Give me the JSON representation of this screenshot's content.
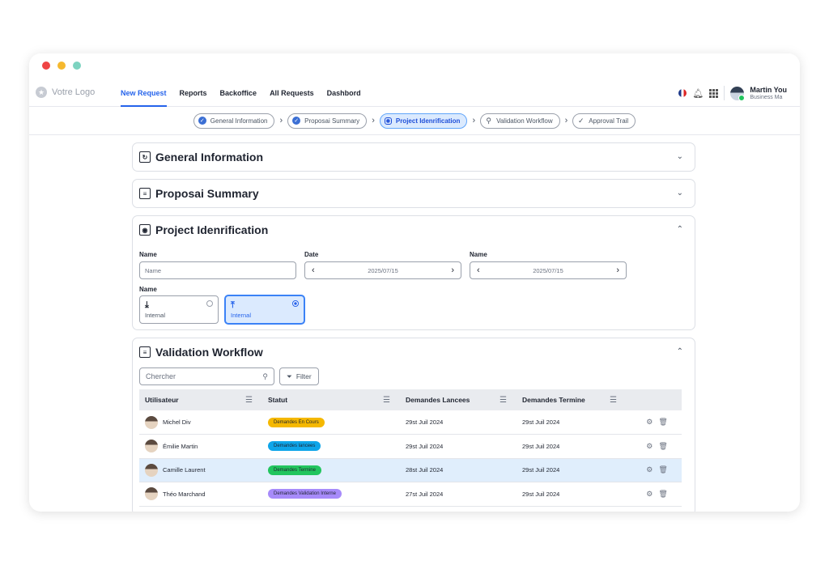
{
  "window": {
    "dots": [
      "#ef4444",
      "#f5b82e",
      "#7dd3c0"
    ]
  },
  "nav": {
    "logo_text": "Votre Logo",
    "items": [
      {
        "label": "New Request",
        "active": true
      },
      {
        "label": "Reports"
      },
      {
        "label": "Backoffice"
      },
      {
        "label": "All Requests"
      },
      {
        "label": "Dashbord"
      }
    ],
    "user": {
      "name": "Martin You",
      "role": "Business Ma"
    },
    "accent": "#2563eb"
  },
  "steps": [
    {
      "label": "General Information",
      "icon": "check-circle-icon",
      "state": "done"
    },
    {
      "label": "Proposai Summary",
      "icon": "check-circle-icon",
      "state": "done"
    },
    {
      "label": "Project Idenrification",
      "icon": "scan-icon",
      "state": "active"
    },
    {
      "label": "Validation Workflow",
      "icon": "workflow-icon",
      "state": "pending"
    },
    {
      "label": "Approval Trail",
      "icon": "checkmark-icon",
      "state": "pending"
    }
  ],
  "sections": {
    "general": {
      "title": "General Information"
    },
    "proposal": {
      "title": "Proposai Summary"
    },
    "project": {
      "title": "Project Idenrification",
      "name_label": "Name",
      "name_placeholder": "Name",
      "date_label": "Date",
      "date_value": "2025/07/15",
      "name2_label": "Name",
      "date2_value": "2025/07/15",
      "radio_label": "Name",
      "radio_options": [
        {
          "label": "Internal",
          "icon": "download-icon",
          "selected": false
        },
        {
          "label": "Internal",
          "icon": "upload-icon",
          "selected": true
        }
      ]
    },
    "validation": {
      "title": "Validation Workflow",
      "search_placeholder": "Chercher",
      "filter_label": "Filter",
      "columns": [
        "Utilisateur",
        "Statut",
        "Demandes Lancees",
        "Demandes Termine"
      ],
      "rows": [
        {
          "user": "Michel Div",
          "status": "Demandes En Cours",
          "status_color": "#f5b800",
          "lancees": "29st Juil 2024",
          "termine": "29st Juil 2024"
        },
        {
          "user": "Émilie Martin",
          "status": "Demandes lancees",
          "status_color": "#0ea5e9",
          "lancees": "29st Juil 2024",
          "termine": "29st Juil 2024"
        },
        {
          "user": "Camille Laurent",
          "status": "Demandes Termine",
          "status_color": "#22c55e",
          "lancees": "28st Juil 2024",
          "termine": "29st Juil 2024",
          "highlight": true
        },
        {
          "user": "Théo Marchand",
          "status": "Demandes Validation Interne",
          "status_color": "#a78bfa",
          "lancees": "27st Juil 2024",
          "termine": "29st Juil 2024"
        }
      ]
    }
  }
}
